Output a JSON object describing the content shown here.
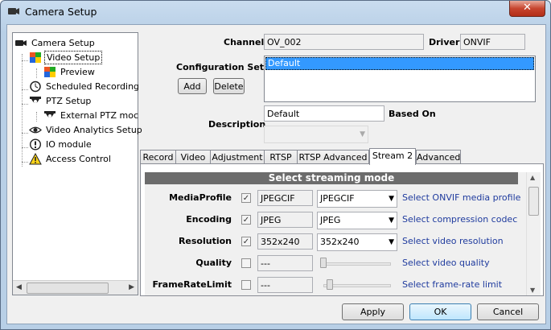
{
  "window": {
    "title": "Camera Setup",
    "close_label": "✕"
  },
  "tree": {
    "items": [
      {
        "label": "Camera Setup",
        "icon": "camera-icon"
      },
      {
        "label": "Video Setup",
        "icon": "video-setup-icon"
      },
      {
        "label": "Preview",
        "icon": "preview-icon"
      },
      {
        "label": "Scheduled Recording",
        "icon": "clock-icon"
      },
      {
        "label": "PTZ Setup",
        "icon": "ptz-camera-icon"
      },
      {
        "label": "External PTZ moc",
        "icon": "ptz-camera-icon"
      },
      {
        "label": "Video Analytics Setup",
        "icon": "eye-icon"
      },
      {
        "label": "IO module",
        "icon": "alert-circle-icon"
      },
      {
        "label": "Access Control",
        "icon": "warning-icon"
      }
    ]
  },
  "form": {
    "channel_label": "Channel",
    "channel_value": "OV_002",
    "driver_label": "Driver",
    "driver_value": "ONVIF",
    "config_sets_label": "Configuration Sets",
    "config_sets": [
      "Default"
    ],
    "add_label": "Add",
    "delete_label": "Delete",
    "description_label": "Description",
    "description_value": "Default",
    "based_on_label": "Based On",
    "based_on_value": ""
  },
  "tabs": [
    {
      "label": "Record"
    },
    {
      "label": "Video"
    },
    {
      "label": "Adjustment"
    },
    {
      "label": "RTSP"
    },
    {
      "label": "RTSP Advanced"
    },
    {
      "label": "Stream 2",
      "active": true
    },
    {
      "label": "Advanced"
    }
  ],
  "stream": {
    "header": "Select streaming mode",
    "rows": [
      {
        "label": "MediaProfile",
        "checked": true,
        "current": "JPEGCIF",
        "control": "select",
        "selected": "JPEGCIF",
        "hint": "Select ONVIF media profile"
      },
      {
        "label": "Encoding",
        "checked": true,
        "current": "JPEG",
        "control": "select",
        "selected": "JPEG",
        "hint": "Select compression codec"
      },
      {
        "label": "Resolution",
        "checked": true,
        "current": "352x240",
        "control": "select",
        "selected": "352x240",
        "hint": "Select video resolution"
      },
      {
        "label": "Quality",
        "checked": false,
        "current": "---",
        "control": "slider",
        "level": 0.0,
        "hint": "Select video quality"
      },
      {
        "label": "FrameRateLimit",
        "checked": false,
        "current": "---",
        "control": "slider",
        "level": 0.1,
        "hint": "Select frame-rate limit"
      }
    ]
  },
  "footer": {
    "apply_label": "Apply",
    "ok_label": "OK",
    "cancel_label": "Cancel"
  }
}
